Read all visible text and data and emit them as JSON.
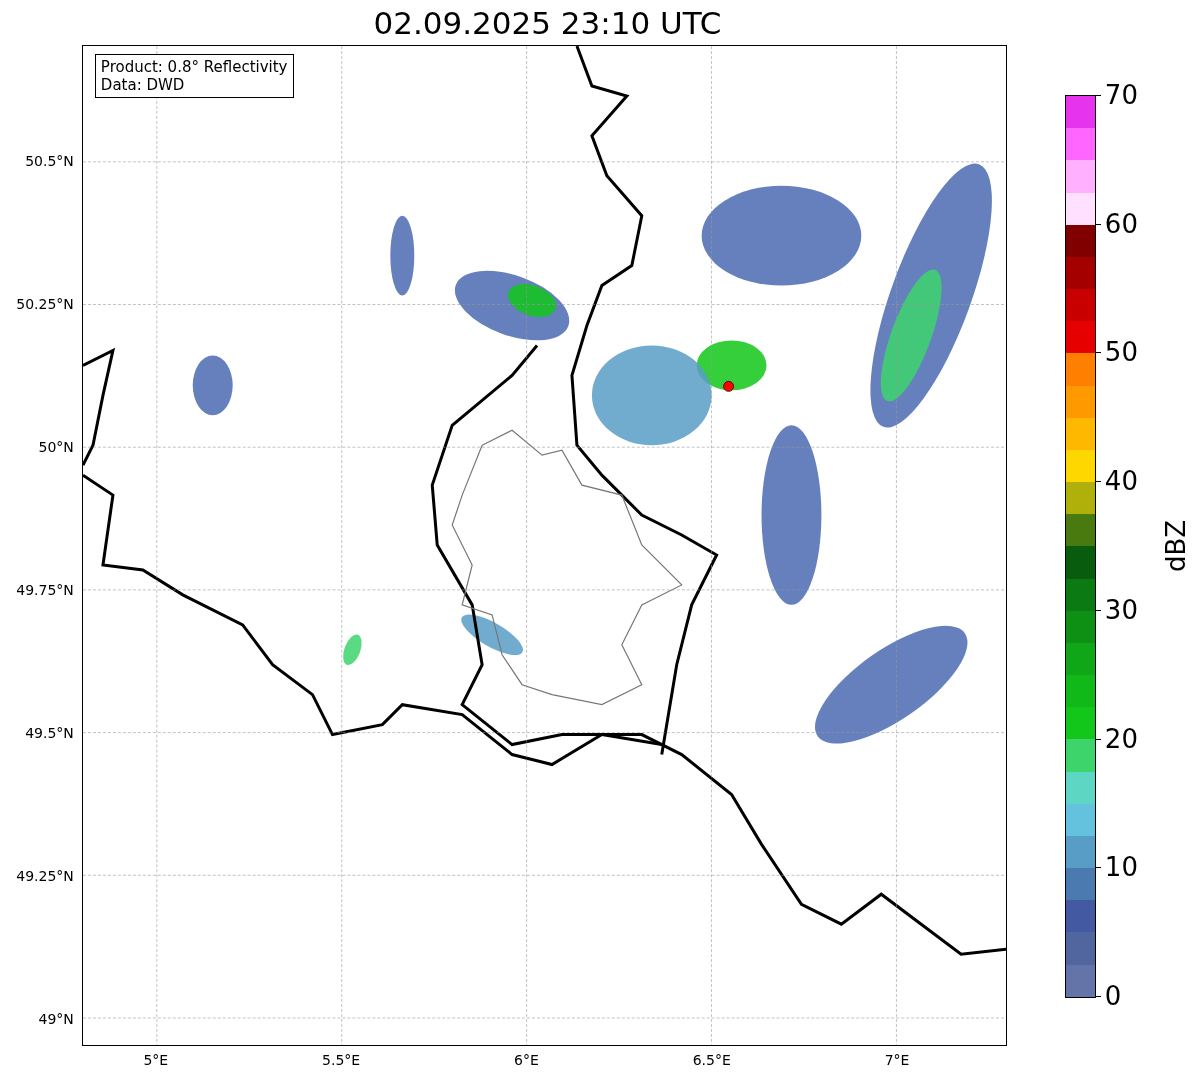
{
  "title": "02.09.2025 23:10 UTC",
  "legend": {
    "lines": [
      "Product: 0.8° Reflectivity",
      "Data: DWD"
    ]
  },
  "map": {
    "x_ticks": [
      "5°E",
      "5.5°E",
      "6°E",
      "6.5°E",
      "7°E"
    ],
    "y_ticks": [
      "50.5°N",
      "50.25°N",
      "50°N",
      "49.75°N",
      "49.5°N",
      "49.25°N",
      "49°N"
    ]
  },
  "colorbar": {
    "label": "dBZ",
    "ticks": [
      "70",
      "60",
      "50",
      "40",
      "30",
      "20",
      "10",
      "0"
    ],
    "bands": [
      {
        "color": "#6574a8"
      },
      {
        "color": "#51659f"
      },
      {
        "color": "#435aa2"
      },
      {
        "color": "#4a7ab0"
      },
      {
        "color": "#589dc6"
      },
      {
        "color": "#65c2de"
      },
      {
        "color": "#5dd6c4"
      },
      {
        "color": "#3dd46c"
      },
      {
        "color": "#12c71a"
      },
      {
        "color": "#10b818"
      },
      {
        "color": "#0fa617"
      },
      {
        "color": "#0e9015"
      },
      {
        "color": "#0b7a12"
      },
      {
        "color": "#085c0e"
      },
      {
        "color": "#487a10"
      },
      {
        "color": "#b0b00a"
      },
      {
        "color": "#ffd700"
      },
      {
        "color": "#ffb800"
      },
      {
        "color": "#ff9900"
      },
      {
        "color": "#ff7f00"
      },
      {
        "color": "#e60000"
      },
      {
        "color": "#c80000"
      },
      {
        "color": "#a50000"
      },
      {
        "color": "#800000"
      },
      {
        "color": "#ffe0ff"
      },
      {
        "color": "#ffb0ff"
      },
      {
        "color": "#ff66ff"
      },
      {
        "color": "#e633ee"
      }
    ]
  }
}
